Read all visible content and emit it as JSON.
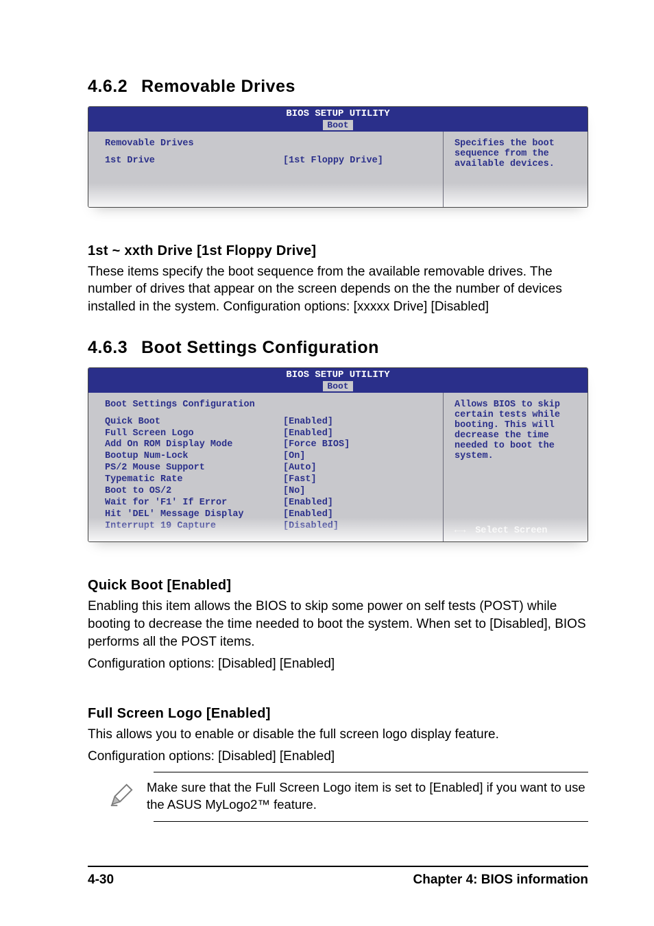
{
  "section1": {
    "number": "4.6.2",
    "title": "Removable Drives",
    "bios": {
      "utility_title": "BIOS SETUP UTILITY",
      "tab": "Boot",
      "panel_title": "Removable Drives",
      "rows": [
        {
          "label": "1st Drive",
          "value": "[1st Floppy Drive]"
        }
      ],
      "help": "Specifies the boot sequence from the available devices."
    },
    "sub": {
      "heading": "1st ~ xxth Drive [1st Floppy Drive]",
      "body": "These items specify the boot sequence from the available removable drives. The number of drives that appear on the screen depends on the the number of devices installed in the system. Configuration options: [xxxxx Drive] [Disabled]"
    }
  },
  "section2": {
    "number": "4.6.3",
    "title": "Boot Settings Configuration",
    "bios": {
      "utility_title": "BIOS SETUP UTILITY",
      "tab": "Boot",
      "panel_title": "Boot Settings Configuration",
      "rows": [
        {
          "label": "Quick Boot",
          "value": "[Enabled]"
        },
        {
          "label": "Full Screen Logo",
          "value": "[Enabled]"
        },
        {
          "label": "Add On ROM Display Mode",
          "value": "[Force BIOS]"
        },
        {
          "label": "Bootup Num-Lock",
          "value": "[On]"
        },
        {
          "label": "PS/2 Mouse Support",
          "value": "[Auto]"
        },
        {
          "label": "Typematic Rate",
          "value": "[Fast]"
        },
        {
          "label": "Boot to OS/2",
          "value": "[No]"
        },
        {
          "label": "Wait for 'F1' If Error",
          "value": "[Enabled]"
        },
        {
          "label": "Hit 'DEL' Message Display",
          "value": "[Enabled]"
        },
        {
          "label": "Interrupt 19 Capture",
          "value": "[Disabled]"
        }
      ],
      "help": "Allows BIOS to skip certain tests while booting. This will decrease the time needed to boot the system.",
      "nav_arrows": "←→",
      "nav_label": "Select Screen"
    },
    "quickboot": {
      "heading": "Quick Boot [Enabled]",
      "body1": "Enabling this item allows the BIOS to skip some power on self tests (POST) while booting to decrease the time needed to boot the system. When set to [Disabled], BIOS performs all the POST items.",
      "body2": "Configuration options: [Disabled] [Enabled]"
    },
    "fullscreen": {
      "heading": "Full Screen Logo [Enabled]",
      "body1": "This allows you to enable or disable the full screen logo display feature.",
      "body2": "Configuration options: [Disabled] [Enabled]"
    },
    "note": "Make sure that the Full Screen Logo item is set to [Enabled] if you want to use the ASUS MyLogo2™ feature."
  },
  "footer": {
    "page": "4-30",
    "chapter": "Chapter 4: BIOS information"
  }
}
